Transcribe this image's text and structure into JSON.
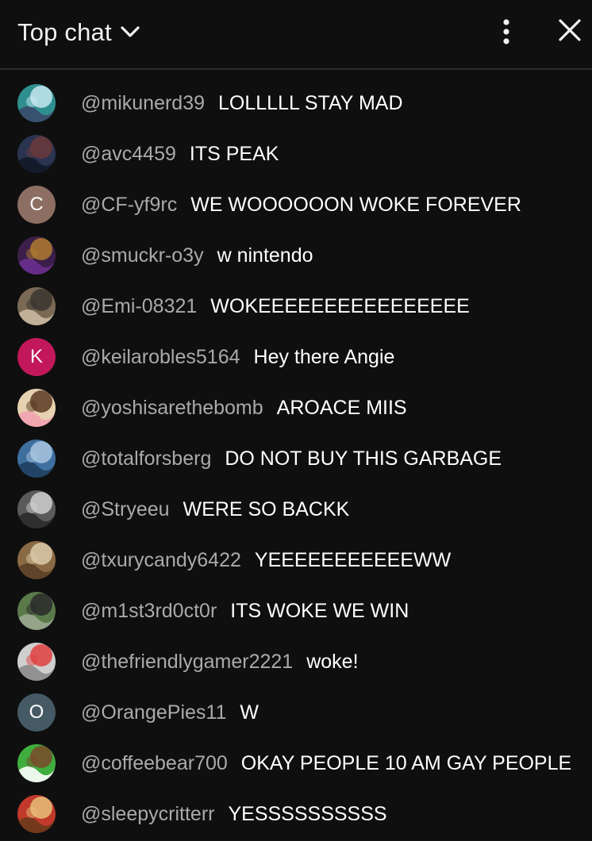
{
  "header": {
    "title": "Top chat",
    "dropdown_icon": "chevron-down-icon",
    "more_icon": "more-vert-icon",
    "close_icon": "close-icon"
  },
  "messages": [
    {
      "author": "@mikunerd39",
      "text": "LOLLLLL STAY MAD",
      "avatar": {
        "type": "image",
        "colors": [
          "#2f8f8f",
          "#c7e8f0",
          "#3a4a6a"
        ]
      }
    },
    {
      "author": "@avc4459",
      "text": "ITS PEAK",
      "avatar": {
        "type": "image",
        "colors": [
          "#2a3350",
          "#6a3a3a",
          "#111827"
        ]
      }
    },
    {
      "author": "@CF-yf9rc",
      "text": "WE WOOOOOON WOKE FOREVER",
      "avatar": {
        "type": "letter",
        "letter": "C",
        "color": "#8d6e63"
      }
    },
    {
      "author": "@smuckr-o3y",
      "text": "w nintendo",
      "avatar": {
        "type": "image",
        "colors": [
          "#3b1f4a",
          "#b07a2e",
          "#6b2f8f"
        ]
      }
    },
    {
      "author": "@Emi-08321",
      "text": "WOKEEEEEEEEEEEEEEEE",
      "avatar": {
        "type": "image",
        "colors": [
          "#7a6a55",
          "#3a3530",
          "#c9b9a0"
        ]
      }
    },
    {
      "author": "@keilarobles5164",
      "text": "Hey there Angie",
      "avatar": {
        "type": "letter",
        "letter": "K",
        "color": "#c2185b"
      }
    },
    {
      "author": "@yoshisarethebomb",
      "text": "AROACE MIIS",
      "avatar": {
        "type": "image",
        "colors": [
          "#e6d2b0",
          "#5a3a22",
          "#f2a2b0"
        ]
      }
    },
    {
      "author": "@totalforsberg",
      "text": "DO NOT BUY THIS GARBAGE",
      "avatar": {
        "type": "image",
        "colors": [
          "#3f6f9f",
          "#a9c7e0",
          "#1f3f5f"
        ]
      }
    },
    {
      "author": "@Stryeeu",
      "text": "WERE SO BACKK",
      "avatar": {
        "type": "image",
        "colors": [
          "#5a5a5a",
          "#cfcfcf",
          "#2a2a2a"
        ]
      }
    },
    {
      "author": "@txurycandy6422",
      "text": "YEEEEEEEEEEEWW",
      "avatar": {
        "type": "image",
        "colors": [
          "#8a6a44",
          "#d9c9a8",
          "#5a4028"
        ]
      }
    },
    {
      "author": "@m1st3rd0ct0r",
      "text": "ITS WOKE WE WIN",
      "avatar": {
        "type": "image",
        "colors": [
          "#5a7a4a",
          "#2a2a2a",
          "#9aa890"
        ]
      }
    },
    {
      "author": "@thefriendlygamer2221",
      "text": "woke!",
      "avatar": {
        "type": "image",
        "colors": [
          "#cfcfcf",
          "#e04040",
          "#8a8a8a"
        ]
      }
    },
    {
      "author": "@OrangePies11",
      "text": "W",
      "avatar": {
        "type": "letter",
        "letter": "O",
        "color": "#455a64"
      }
    },
    {
      "author": "@coffeebear700",
      "text": "OKAY PEOPLE 10 AM GAY PEOPLE",
      "avatar": {
        "type": "image",
        "colors": [
          "#3fae3f",
          "#7a4a2a",
          "#ffffff"
        ]
      }
    },
    {
      "author": "@sleepycritterr",
      "text": "YESSSSSSSSSS",
      "avatar": {
        "type": "image",
        "colors": [
          "#c0392b",
          "#e8c07a",
          "#6a3a1a"
        ]
      }
    }
  ]
}
